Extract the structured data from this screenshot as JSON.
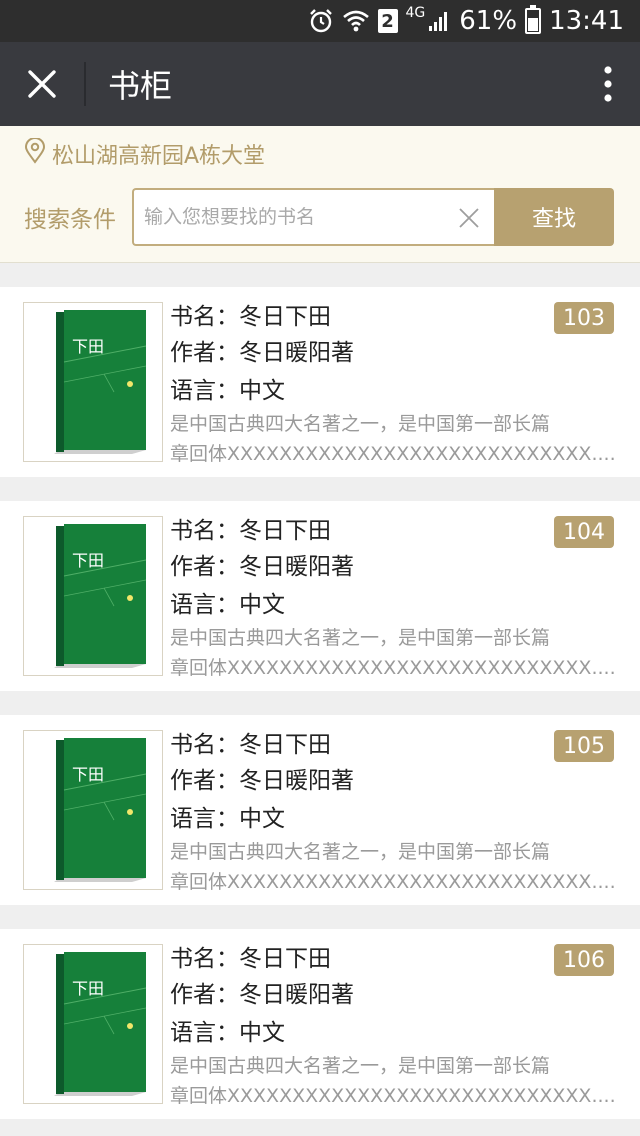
{
  "status_bar": {
    "sim_slot": "2",
    "network": "4G",
    "battery": "61%",
    "battery_level": 0.61,
    "time": "13:41",
    "icons": [
      "alarm-icon",
      "wifi-icon",
      "signal-icon",
      "battery-icon"
    ]
  },
  "nav": {
    "title": "书柜",
    "close_icon": "close-icon",
    "more_icon": "more-vertical-icon"
  },
  "location": {
    "text": "松山湖高新园A栋大堂",
    "icon": "location-pin-icon"
  },
  "search": {
    "label": "搜索条件",
    "placeholder": "输入您想要找的书名",
    "value": "",
    "button_label": "查找"
  },
  "colors": {
    "accent": "#b7a170",
    "accent_text": "#b29c6a",
    "nav_bg": "#393a3f",
    "status_bg": "#2e2e2e"
  },
  "books": [
    {
      "badge": "103",
      "title_line": "书名：冬日下田",
      "author_line": "作者：冬日暖阳著",
      "lang_line": "语言：中文",
      "desc_line1": "是中国古典四大名著之一，是中国第一部长篇",
      "desc_line2": "章回体XXXXXXXXXXXXXXXXXXXXXXXXXXXX.....",
      "cover_title": "下田"
    },
    {
      "badge": "104",
      "title_line": "书名：冬日下田",
      "author_line": "作者：冬日暖阳著",
      "lang_line": "语言：中文",
      "desc_line1": "是中国古典四大名著之一，是中国第一部长篇",
      "desc_line2": "章回体XXXXXXXXXXXXXXXXXXXXXXXXXXXX.....",
      "cover_title": "下田"
    },
    {
      "badge": "105",
      "title_line": "书名：冬日下田",
      "author_line": "作者：冬日暖阳著",
      "lang_line": "语言：中文",
      "desc_line1": "是中国古典四大名著之一，是中国第一部长篇",
      "desc_line2": "章回体XXXXXXXXXXXXXXXXXXXXXXXXXXXX.....",
      "cover_title": "下田"
    },
    {
      "badge": "106",
      "title_line": "书名：冬日下田",
      "author_line": "作者：冬日暖阳著",
      "lang_line": "语言：中文",
      "desc_line1": "是中国古典四大名著之一，是中国第一部长篇",
      "desc_line2": "章回体XXXXXXXXXXXXXXXXXXXXXXXXXXXX.....",
      "cover_title": "下田"
    }
  ]
}
